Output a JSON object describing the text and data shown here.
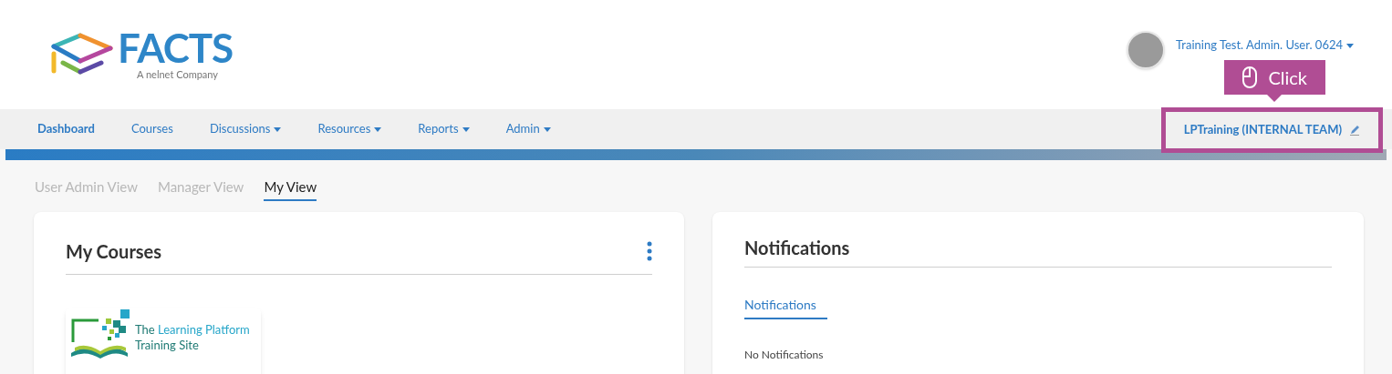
{
  "logo": {
    "wordmark": "FACTS",
    "tagline": "A nelnet Company"
  },
  "user": {
    "name": "Training Test. Admin. User. 0624"
  },
  "nav": {
    "items": [
      {
        "label": "Dashboard",
        "selected": true,
        "has_menu": false
      },
      {
        "label": "Courses",
        "selected": false,
        "has_menu": false
      },
      {
        "label": "Discussions",
        "selected": false,
        "has_menu": true
      },
      {
        "label": "Resources",
        "selected": false,
        "has_menu": true
      },
      {
        "label": "Reports",
        "selected": false,
        "has_menu": true
      },
      {
        "label": "Admin",
        "selected": false,
        "has_menu": true
      }
    ],
    "site": "LPTraining (INTERNAL TEAM)"
  },
  "callout": {
    "label": "Click"
  },
  "view_tabs": [
    {
      "label": "User Admin View",
      "selected": false
    },
    {
      "label": "Manager View",
      "selected": false
    },
    {
      "label": "My View",
      "selected": true
    }
  ],
  "my_courses": {
    "title": "My Courses",
    "course": {
      "line_1_start": "The",
      "line_1_accent": "Learning Platform",
      "line_2": "Training Site"
    }
  },
  "notifications": {
    "title": "Notifications",
    "tabs": [
      {
        "label": "Notifications",
        "selected": true
      }
    ],
    "empty_text": "No Notifications"
  }
}
